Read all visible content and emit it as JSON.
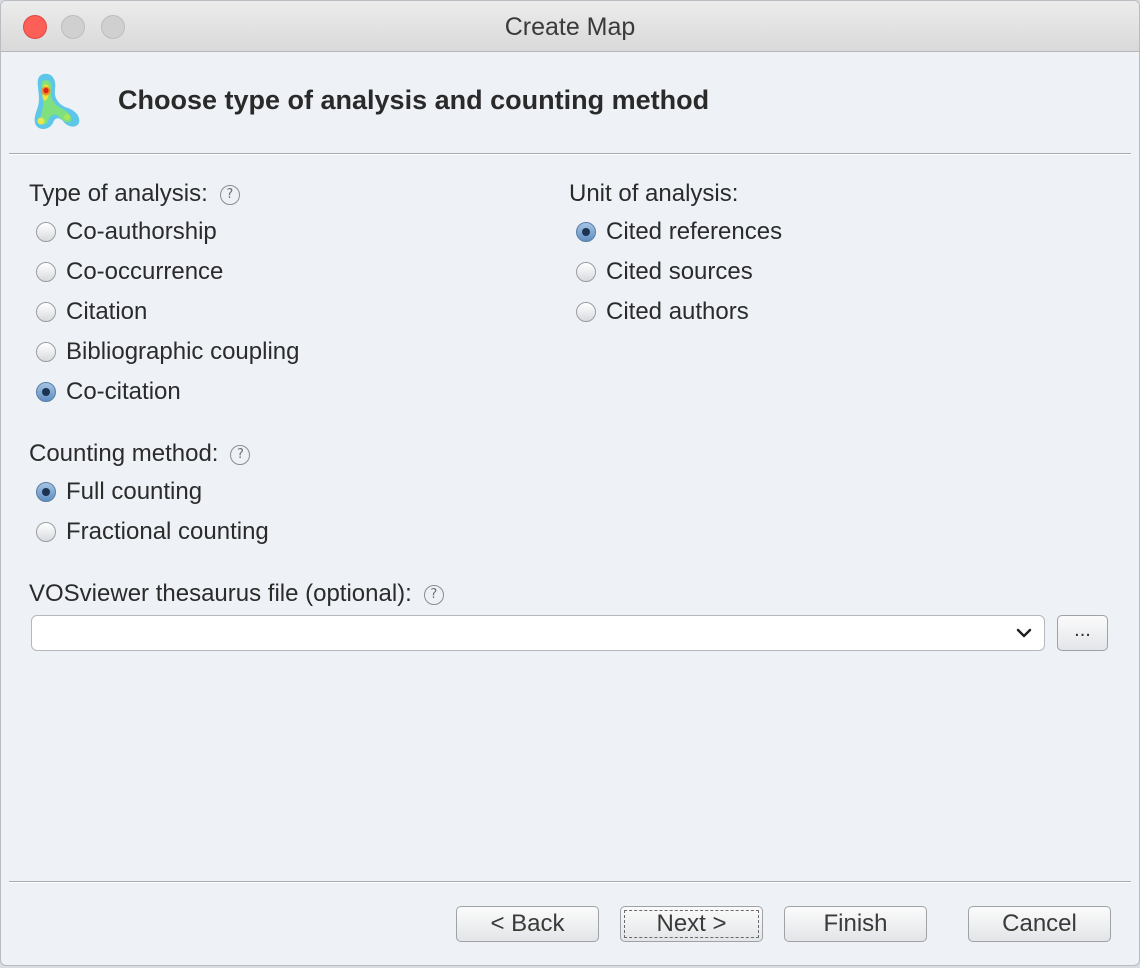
{
  "window": {
    "title": "Create Map"
  },
  "header": {
    "title": "Choose type of analysis and counting method"
  },
  "help_glyph": "?",
  "type_of_analysis": {
    "label": "Type of analysis:",
    "options": [
      "Co-authorship",
      "Co-occurrence",
      "Citation",
      "Bibliographic coupling",
      "Co-citation"
    ],
    "selected": "Co-citation"
  },
  "unit_of_analysis": {
    "label": "Unit of analysis:",
    "options": [
      "Cited references",
      "Cited sources",
      "Cited authors"
    ],
    "selected": "Cited references"
  },
  "counting_method": {
    "label": "Counting method:",
    "options": [
      "Full counting",
      "Fractional counting"
    ],
    "selected": "Full counting"
  },
  "thesaurus": {
    "label": "VOSviewer thesaurus file (optional):",
    "value": "",
    "browse_label": "..."
  },
  "buttons": {
    "back": "< Back",
    "next": "Next >",
    "finish": "Finish",
    "cancel": "Cancel"
  },
  "icons": {
    "logo": "vosviewer-logo-icon",
    "help": "help-icon",
    "dropdown": "chevron-down-icon"
  },
  "colors": {
    "background": "#eef2f6",
    "radio_selected": "#5f8fc2",
    "close_button": "#fc5f57"
  }
}
